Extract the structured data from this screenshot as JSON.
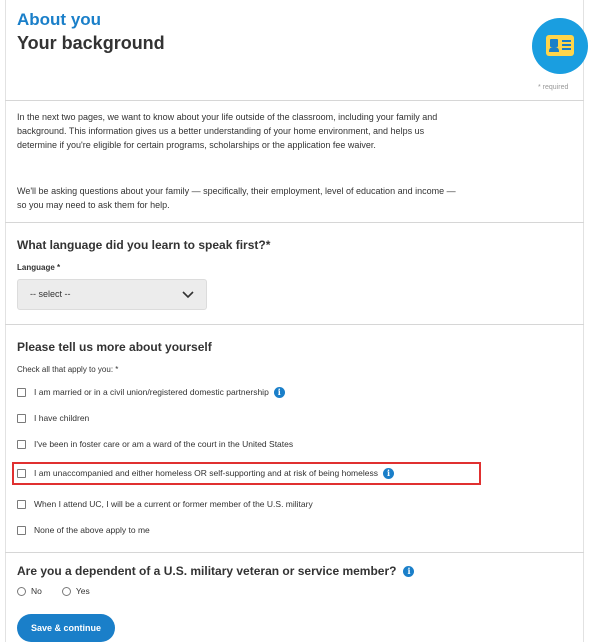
{
  "header": {
    "section_title": "About you",
    "page_title": "Your background",
    "required_note": "* required",
    "badge_icon": "id-card-icon",
    "badge_color": "#1a9ee0",
    "accent_color": "#1a7fc9"
  },
  "intro": {
    "paragraph1": "In the next two pages, we want to know about your life outside of the classroom, including your family and background. This information gives us a better understanding of your home environment, and helps us determine if you're eligible for certain programs, scholarships or the application fee waiver.",
    "paragraph2": "We'll be asking questions about your family — specifically, their employment, level of education and income — so you may need to ask them for help."
  },
  "language": {
    "question": "What language did you learn to speak first?*",
    "field_label": "Language *",
    "selected_value": "-- select --"
  },
  "about_yourself": {
    "question": "Please tell us more about yourself",
    "instruction": "Check all that apply to you: *",
    "options": [
      {
        "label": "I am married or in a civil union/registered domestic partnership",
        "checked": false,
        "has_info": true
      },
      {
        "label": "I have children",
        "checked": false,
        "has_info": false
      },
      {
        "label": "I've been in foster care or am a ward of the court in the United States",
        "checked": false,
        "has_info": false
      },
      {
        "label": "I am unaccompanied and either homeless OR self-supporting and at risk of being homeless",
        "checked": false,
        "has_info": true,
        "highlighted": true
      },
      {
        "label": "When I attend UC, I will be a current or former member of the U.S. military",
        "checked": false,
        "has_info": false
      },
      {
        "label": "None of the above apply to me",
        "checked": false,
        "has_info": false
      }
    ],
    "highlight_color": "#e03030"
  },
  "military": {
    "question": "Are you a dependent of a U.S. military veteran or service member?",
    "options": [
      "No",
      "Yes"
    ]
  },
  "actions": {
    "save_label": "Save & continue"
  }
}
